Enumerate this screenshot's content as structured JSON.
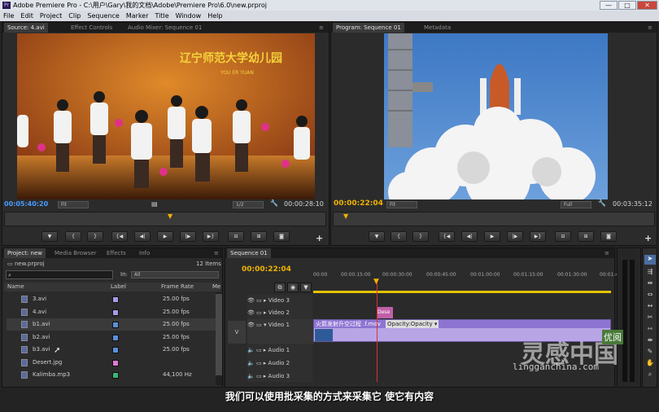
{
  "window": {
    "title": "Adobe Premiere Pro - C:\\用户\\Gary\\我的文档\\Adobe\\Premiere Pro\\6.0\\new.prproj",
    "app_icon": "Pr",
    "min": "—",
    "max": "□",
    "close": "✕"
  },
  "menu": [
    "File",
    "Edit",
    "Project",
    "Clip",
    "Sequence",
    "Marker",
    "Title",
    "Window",
    "Help"
  ],
  "source": {
    "tabs": [
      "Source: 4.avi",
      "Effect Controls",
      "Audio Mixer: Sequence 01"
    ],
    "timecode": "00:05:40:20",
    "fit": "Fit",
    "quality": "1/2",
    "duration": "00:00:28:10",
    "banner": "辽宁师范大学幼儿园",
    "banner_sub": "YOU ER YUAN"
  },
  "program": {
    "tabs": [
      "Program: Sequence 01",
      "Metadata"
    ],
    "timecode": "00:00:22:04",
    "fit": "Fit",
    "quality": "Full",
    "duration": "00:03:35:12"
  },
  "project": {
    "tabs": [
      "Project: new",
      "Media Browser",
      "Effects",
      "Info"
    ],
    "filename": "new.prproj",
    "count": "12 Items",
    "in_label": "In:",
    "in_value": "All",
    "columns": [
      "Name",
      "Label",
      "Frame Rate",
      "Me"
    ],
    "rows": [
      {
        "name": "3.avi",
        "rate": "25.00 fps",
        "color": "#a59ae8"
      },
      {
        "name": "4.avi",
        "rate": "25.00 fps",
        "color": "#a59ae8"
      },
      {
        "name": "b1.avi",
        "rate": "25.00 fps",
        "color": "#5c8fd8"
      },
      {
        "name": "b2.avi",
        "rate": "25.00 fps",
        "color": "#5c8fd8"
      },
      {
        "name": "b3.avi",
        "rate": "25.00 fps",
        "color": "#5c8fd8"
      },
      {
        "name": "Desert.jpg",
        "rate": "",
        "color": "#e07ad0"
      },
      {
        "name": "Kalimba.mp3",
        "rate": "44,100 Hz",
        "color": "#3cb37a"
      }
    ]
  },
  "sequence": {
    "tab": "Sequence 01",
    "timecode": "00:00:22:04",
    "ruler": [
      "00:00",
      "00:00:15:00",
      "00:00:30:00",
      "00:00:45:00",
      "00:01:00:00",
      "00:01:15:00",
      "00:01:30:00",
      "00:01:45:00"
    ],
    "tracks": [
      {
        "name": "Video 3"
      },
      {
        "name": "Video 2"
      },
      {
        "name": "Video 1"
      },
      {
        "name": "Audio 1"
      },
      {
        "name": "Audio 2"
      },
      {
        "name": "Audio 3"
      }
    ],
    "v_label": "V",
    "clip_desert": "Dese",
    "clip_launch": "火箭发射升空过程 .f.mov",
    "clip_opacity": "Opacity:Opacity ▾"
  },
  "subtitle": "我们可以使用批采集的方式来采集它 使它有内容",
  "watermark": {
    "logo": "灵感中国",
    "sub": "lingganchina.com",
    "stamp": "优阅"
  },
  "colors": {
    "accent_blue": "#4a9cff",
    "playhead": "#f1b400",
    "clip_purple": "#a88fd8"
  }
}
